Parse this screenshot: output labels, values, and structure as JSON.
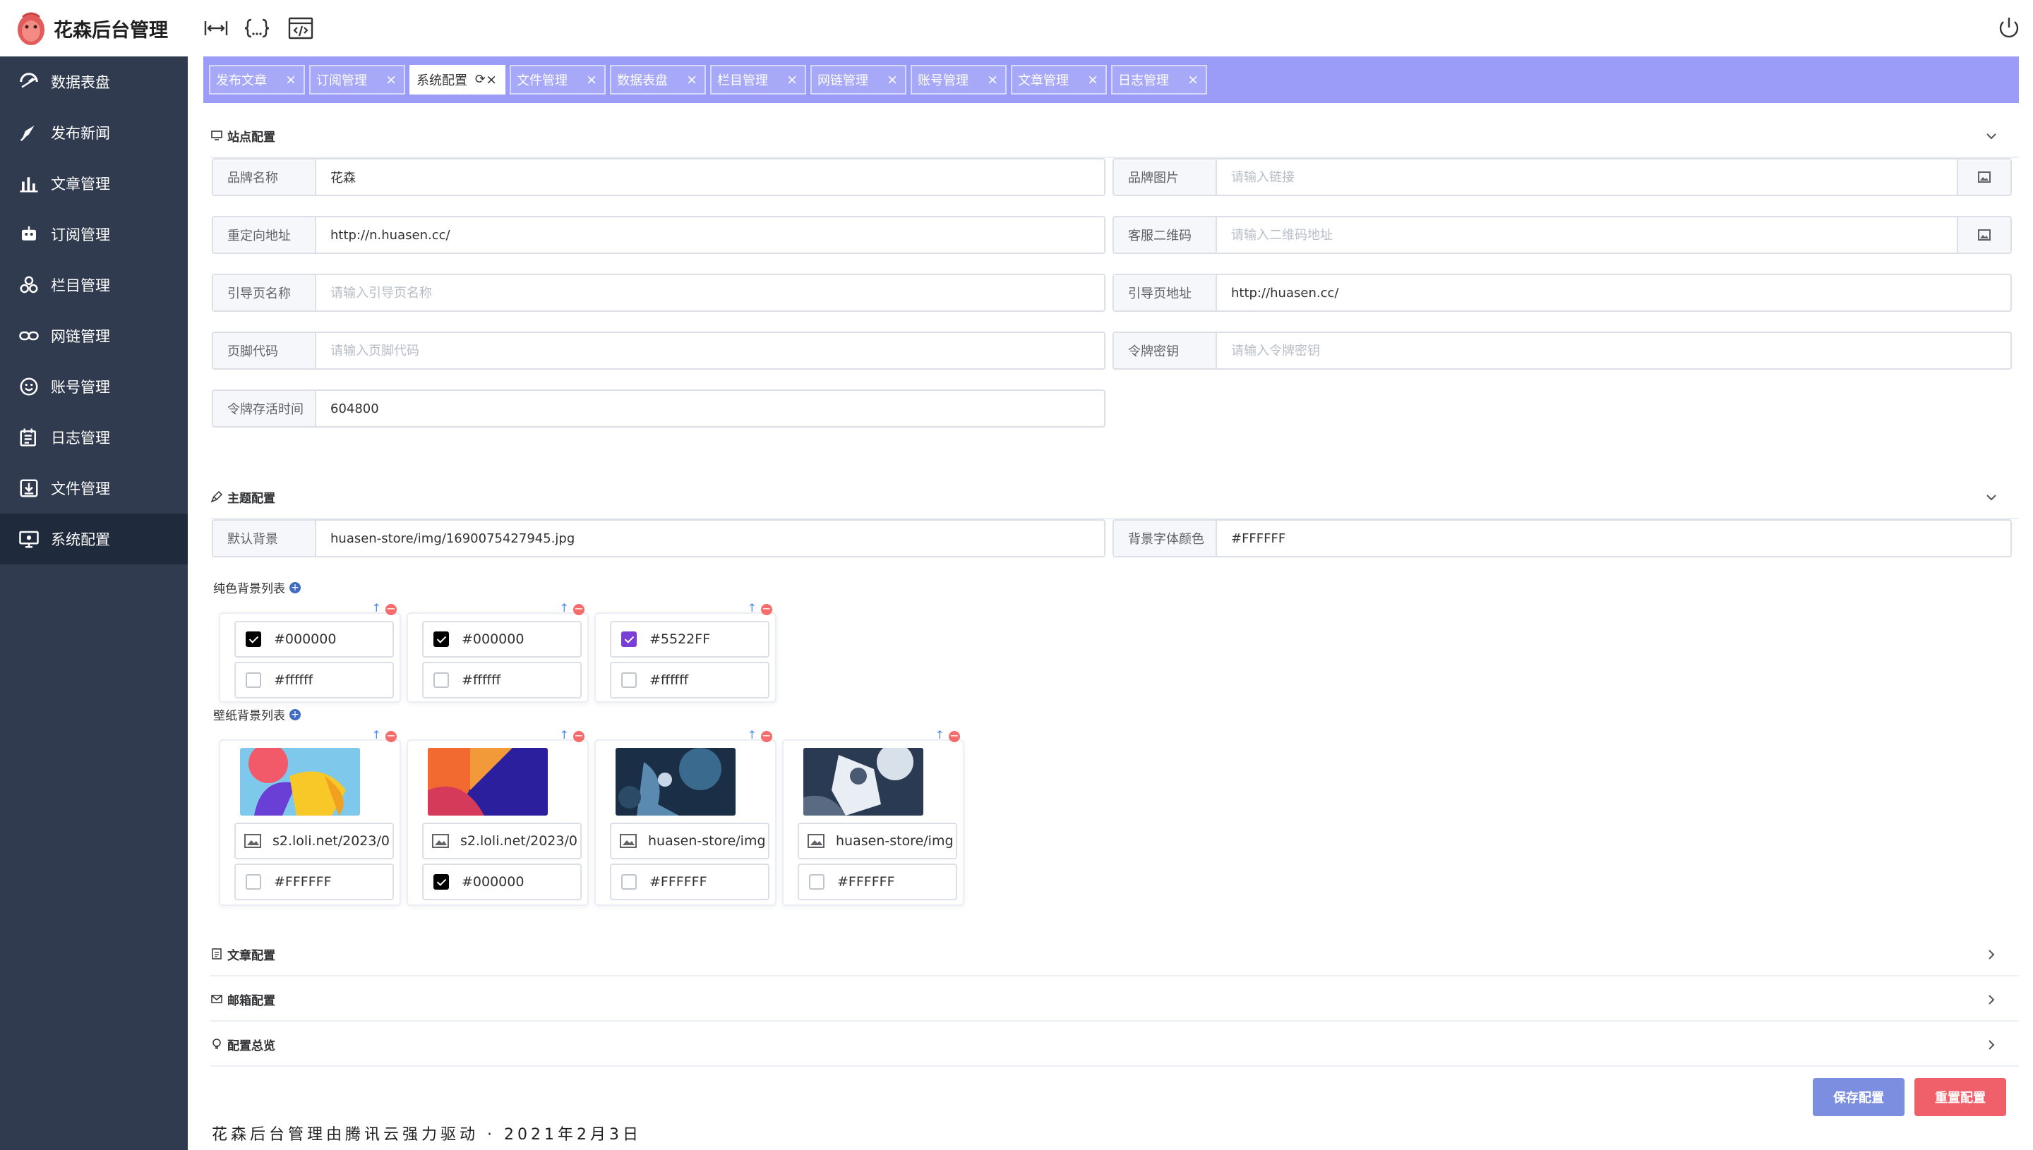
{
  "app": {
    "title": "花森后台管理"
  },
  "sidebar": {
    "items": [
      {
        "label": "数据表盘",
        "icon": "dashboard-icon"
      },
      {
        "label": "发布新闻",
        "icon": "publish-icon"
      },
      {
        "label": "文章管理",
        "icon": "bar-chart-icon"
      },
      {
        "label": "订阅管理",
        "icon": "robot-icon"
      },
      {
        "label": "栏目管理",
        "icon": "cluster-icon"
      },
      {
        "label": "网链管理",
        "icon": "link-icon"
      },
      {
        "label": "账号管理",
        "icon": "smile-icon"
      },
      {
        "label": "日志管理",
        "icon": "log-icon"
      },
      {
        "label": "文件管理",
        "icon": "file-save-icon"
      },
      {
        "label": "系统配置",
        "icon": "system-config-icon"
      }
    ]
  },
  "tabs": [
    {
      "label": "发布文章"
    },
    {
      "label": "订阅管理"
    },
    {
      "label": "系统配置",
      "active": true
    },
    {
      "label": "文件管理"
    },
    {
      "label": "数据表盘"
    },
    {
      "label": "栏目管理"
    },
    {
      "label": "网链管理"
    },
    {
      "label": "账号管理"
    },
    {
      "label": "文章管理"
    },
    {
      "label": "日志管理"
    }
  ],
  "site": {
    "title": "站点配置",
    "brand_name": {
      "label": "品牌名称",
      "value": "花森"
    },
    "brand_image": {
      "label": "品牌图片",
      "placeholder": "请输入链接"
    },
    "redirect": {
      "label": "重定向地址",
      "value": "http://n.huasen.cc/"
    },
    "qrcode": {
      "label": "客服二维码",
      "placeholder": "请输入二维码地址"
    },
    "guide_name": {
      "label": "引导页名称",
      "placeholder": "请输入引导页名称"
    },
    "guide_url": {
      "label": "引导页地址",
      "value": "http://huasen.cc/"
    },
    "footer_code": {
      "label": "页脚代码",
      "placeholder": "请输入页脚代码"
    },
    "token_secret": {
      "label": "令牌密钥",
      "placeholder": "请输入令牌密钥"
    },
    "token_ttl": {
      "label": "令牌存活时间",
      "value": "604800"
    }
  },
  "theme": {
    "title": "主题配置",
    "default_bg": {
      "label": "默认背景",
      "value": "huasen-store/img/1690075427945.jpg"
    },
    "bg_font_color": {
      "label": "背景字体颜色",
      "value": "#FFFFFF"
    },
    "solid_title": "纯色背景列表",
    "solid": [
      {
        "bg": "#000000",
        "font": "#ffffff",
        "bg_swatch": "#000000"
      },
      {
        "bg": "#000000",
        "font": "#ffffff",
        "bg_swatch": "#000000"
      },
      {
        "bg": "#5522FF",
        "font": "#ffffff",
        "bg_swatch": "#7a3fd6"
      }
    ],
    "wall_title": "壁纸背景列表",
    "wallpapers": [
      {
        "url": "s2.loli.net/2023/0",
        "font": "#FFFFFF",
        "checked": false
      },
      {
        "url": "s2.loli.net/2023/0",
        "font": "#000000",
        "checked": true
      },
      {
        "url": "huasen-store/img",
        "font": "#FFFFFF",
        "checked": false
      },
      {
        "url": "huasen-store/img",
        "font": "#FFFFFF",
        "checked": false
      }
    ]
  },
  "article": {
    "title": "文章配置"
  },
  "mail": {
    "title": "邮箱配置"
  },
  "overview": {
    "title": "配置总览"
  },
  "buttons": {
    "save": "保存配置",
    "reset": "重置配置"
  },
  "footer": "花森后台管理由腾讯云强力驱动 · 2021年2月3日"
}
